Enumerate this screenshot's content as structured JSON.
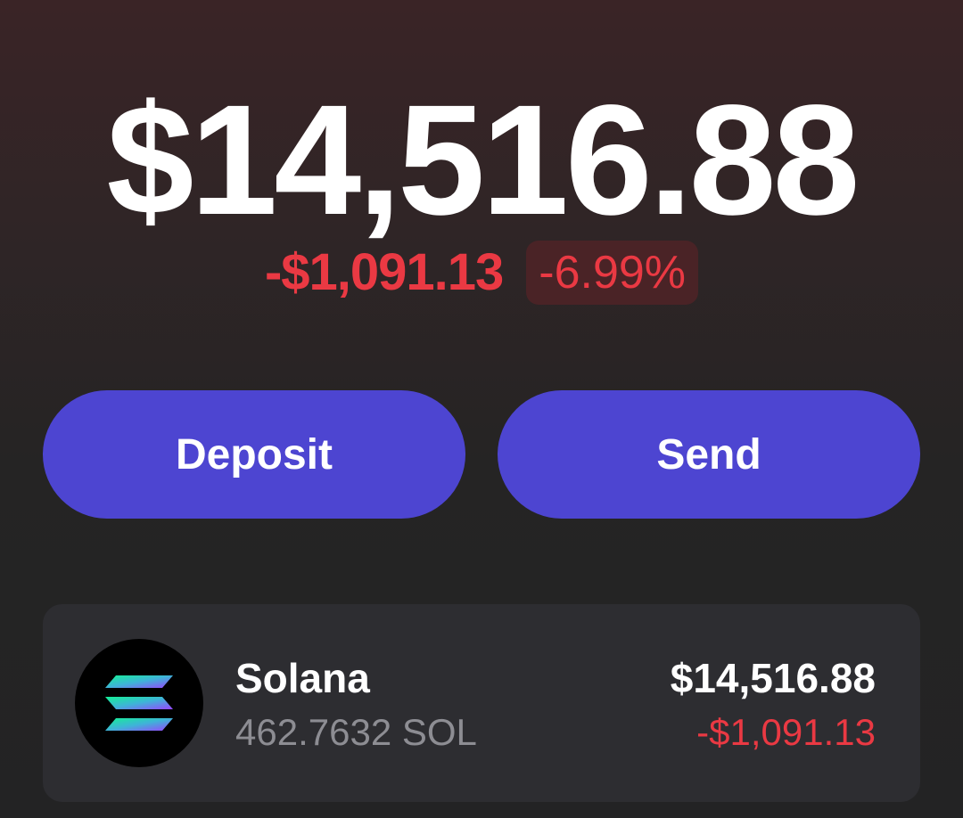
{
  "portfolio": {
    "total_balance": "$14,516.88",
    "change_amount": "-$1,091.13",
    "change_percent": "-6.99%"
  },
  "actions": {
    "deposit_label": "Deposit",
    "send_label": "Send"
  },
  "tokens": [
    {
      "name": "Solana",
      "amount": "462.7632 SOL",
      "value": "$14,516.88",
      "change": "-$1,091.13",
      "icon": "solana-icon"
    }
  ],
  "colors": {
    "accent": "#4d45d1",
    "negative": "#ea3943",
    "card_background": "#2d2d31",
    "solana_gradient_start": "#14f195",
    "solana_gradient_end": "#9945ff"
  }
}
